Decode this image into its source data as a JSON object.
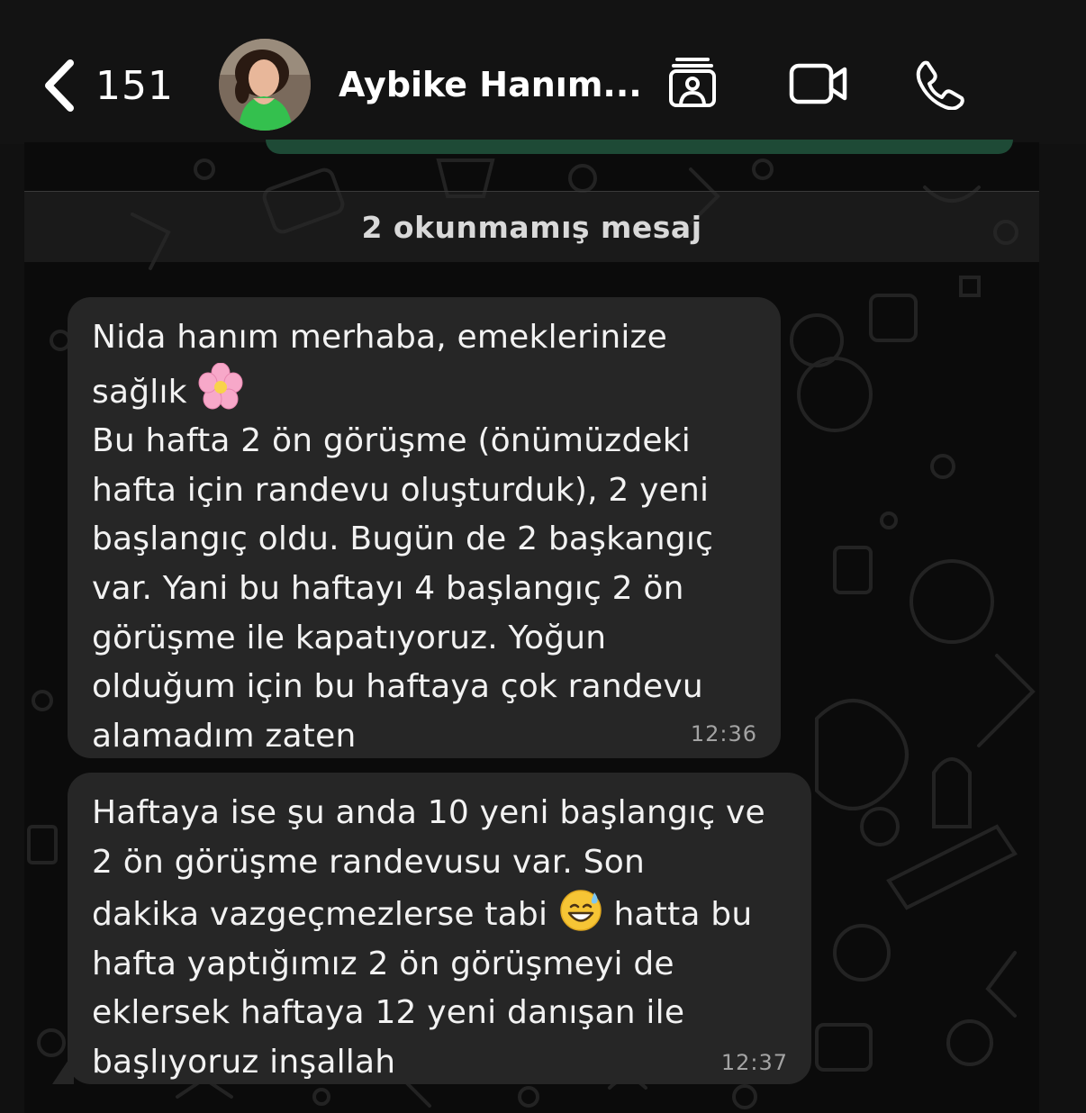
{
  "header": {
    "back_count": "151",
    "contact_name": "Aybike Hanım...",
    "icons": [
      "chevron-left-icon",
      "contact-card-icon",
      "video-call-icon",
      "phone-icon"
    ]
  },
  "chat": {
    "unread_label": "2 okunmamış mesaj",
    "messages": [
      {
        "lines": [
          "Nida hanım merhaba, emeklerinize",
          "sağlık",
          "Bu hafta 2 ön görüşme (önümüzdeki",
          "hafta için randevu oluşturduk), 2 yeni",
          "başlangıç oldu. Bugün de 2 başkangıç",
          "var. Yani bu haftayı 4 başlangıç 2 ön",
          "görüşme ile kapatıyoruz. Yoğun",
          "olduğum için bu haftaya çok randevu",
          "alamadım zaten"
        ],
        "emoji": "cherry-blossom",
        "time": "12:36"
      },
      {
        "lines": [
          "Haftaya ise şu anda 10 yeni başlangıç ve",
          "2 ön görüşme randevusu var. Son",
          "dakika vazgeçmezlerse tabi",
          "hatta bu",
          "hafta yaptığımız 2 ön görüşmeyi de",
          "eklersek haftaya 12 yeni danışan ile",
          "başlıyoruz inşallah"
        ],
        "emoji": "grinning-face-with-sweat",
        "time": "12:37"
      }
    ]
  },
  "colors": {
    "background": "#111111",
    "bubble": "#262626",
    "outgoing_bubble": "#1e4a36",
    "timestamp": "#a3a3a3"
  }
}
